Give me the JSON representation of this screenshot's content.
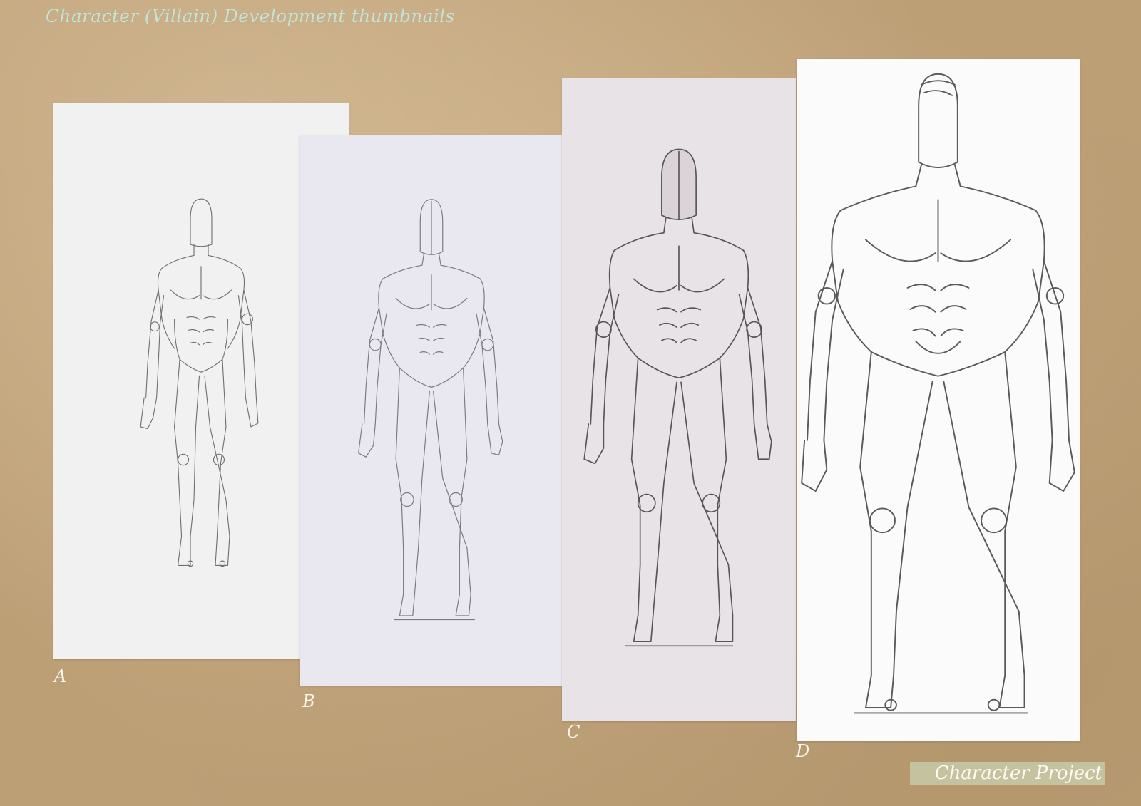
{
  "page": {
    "title": "Character (Villain) Development thumbnails",
    "footer_label": "Character Project"
  },
  "thumbnails": [
    {
      "label": "A",
      "sheet_color": "#f2f1f1"
    },
    {
      "label": "B",
      "sheet_color": "#e9e8f0"
    },
    {
      "label": "C",
      "sheet_color": "#e8e3e6"
    },
    {
      "label": "D",
      "sheet_color": "#fbfbfb"
    }
  ],
  "colors": {
    "background": "#c8ab82",
    "title_text": "#c8e2d3",
    "label_text": "#fbf7ee",
    "footer_box": "#c3c3a0",
    "pencil": "#6e6e6e"
  }
}
